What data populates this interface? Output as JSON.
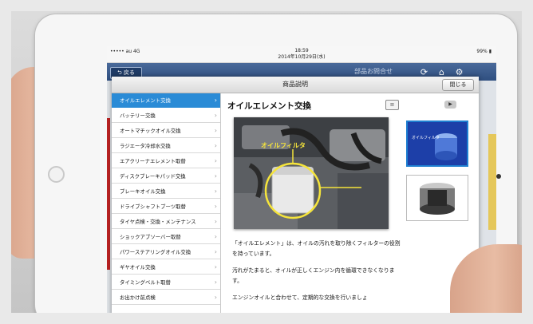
{
  "status_bar": {
    "carrier": "••••• au  4G",
    "time": "18:59",
    "date": "2014年10月29日(水)",
    "battery": "99%"
  },
  "app_header": {
    "back_label": "戻る",
    "title": "部品お問合せ"
  },
  "modal": {
    "title": "商品説明",
    "close_label": "閉じる"
  },
  "sidebar": {
    "items": [
      {
        "label": "オイルエレメント交換",
        "active": true
      },
      {
        "label": "バッテリー交換"
      },
      {
        "label": "オートマチックオイル交換"
      },
      {
        "label": "ラジエータ冷却水交換"
      },
      {
        "label": "エアクリーナエレメント取替"
      },
      {
        "label": "ディスクブレーキパッド交換"
      },
      {
        "label": "ブレーキオイル交換"
      },
      {
        "label": "ドライブシャフトブーツ取替"
      },
      {
        "label": "タイヤ点検・交換・メンテナンス"
      },
      {
        "label": "ショックアブソーバー取替"
      },
      {
        "label": "パワーステアリングオイル交換"
      },
      {
        "label": "ギヤオイル交換"
      },
      {
        "label": "タイミングベルト取替"
      },
      {
        "label": "お出かけ前点検"
      }
    ]
  },
  "content": {
    "title": "オイルエレメント交換",
    "photo_caption": "オイルフィルタ",
    "thumb_caption": "オイルフィルタ",
    "paragraphs": [
      "「オイルエレメント」は、オイルの汚れを取り除くフィルターの役割を持っています。",
      "汚れがたまると、オイルが正しくエンジン内を循環できなくなります。",
      "エンジンオイルと合わせて、定期的な交換を行いましょ"
    ]
  },
  "colors": {
    "accent": "#2a8bd6",
    "header_blue": "#2f4f80",
    "highlight_yellow": "#f5e43b"
  }
}
